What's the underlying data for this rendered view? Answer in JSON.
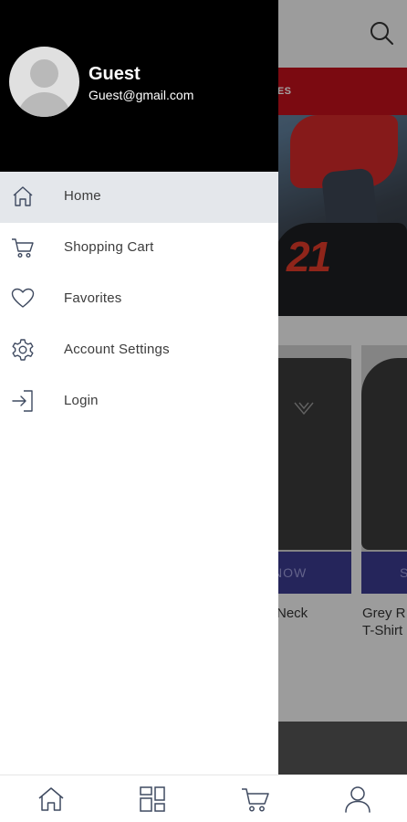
{
  "promo": {
    "text": "SES"
  },
  "hero": {
    "number": "21"
  },
  "products": [
    {
      "button_label": "NOW",
      "name_lines": [
        "Neck"
      ]
    },
    {
      "button_label": "S",
      "name_lines": [
        "Grey R",
        "T-Shirt"
      ]
    }
  ],
  "drawer": {
    "user": {
      "name": "Guest",
      "email": "Guest@gmail.com"
    },
    "menu": [
      {
        "label": "Home",
        "icon": "home-icon",
        "active": true
      },
      {
        "label": "Shopping Cart",
        "icon": "cart-icon",
        "active": false
      },
      {
        "label": "Favorites",
        "icon": "heart-icon",
        "active": false
      },
      {
        "label": "Account Settings",
        "icon": "gear-icon",
        "active": false
      },
      {
        "label": "Login",
        "icon": "login-icon",
        "active": false
      }
    ]
  },
  "bottom_nav": [
    "home-icon",
    "categories-icon",
    "cart-icon",
    "profile-icon"
  ],
  "colors": {
    "drawer_header": "#000000",
    "active_item": "#e4e7eb",
    "promo_bar": "#c0111b",
    "product_button": "#3b3a8f",
    "icon_stroke": "#3f4a60"
  }
}
